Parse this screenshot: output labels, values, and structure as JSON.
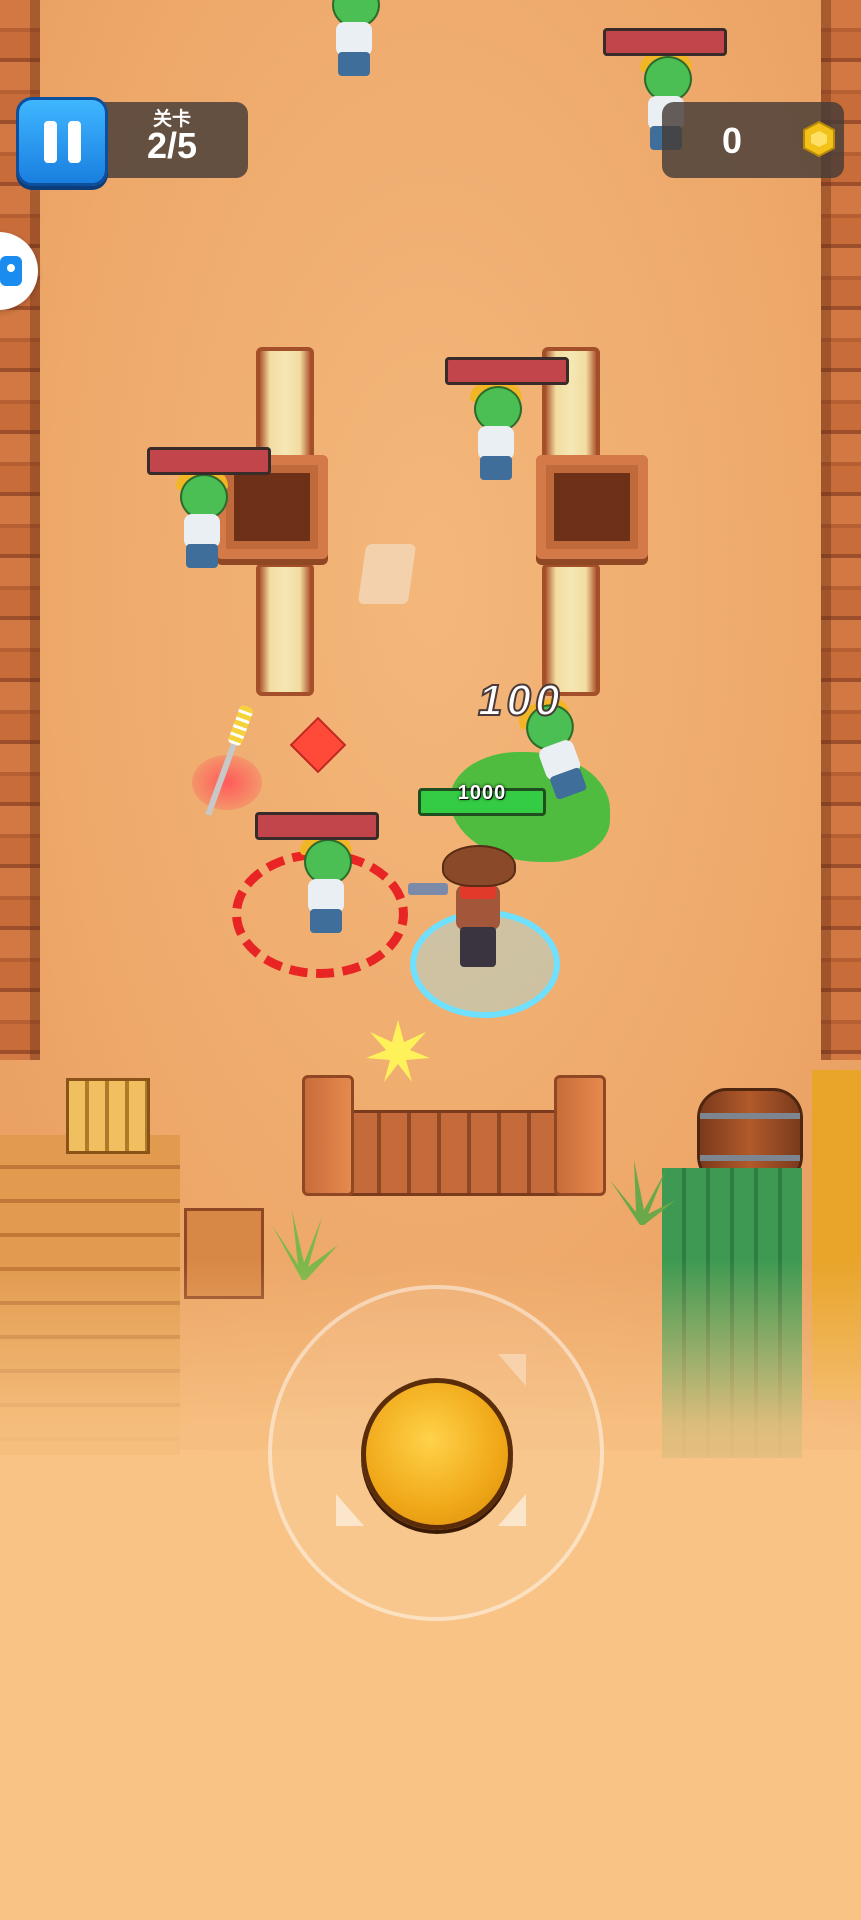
{
  "hud": {
    "level_label": "关卡",
    "level_value": "2/5",
    "coins": "0",
    "pause_icon": "pause-icon",
    "coin_icon": "hex-coin-icon"
  },
  "player": {
    "hp_value": "1000",
    "hp_fraction": 1.0
  },
  "combat": {
    "damage_text": "100"
  },
  "colors": {
    "pause_button": "#1a7fe0",
    "player_hp": "#33cc44",
    "enemy_hp": "#c2454c",
    "joystick_knob": "#f0a818",
    "target_ring": "#e82424",
    "player_ring": "#6fe0ff"
  }
}
